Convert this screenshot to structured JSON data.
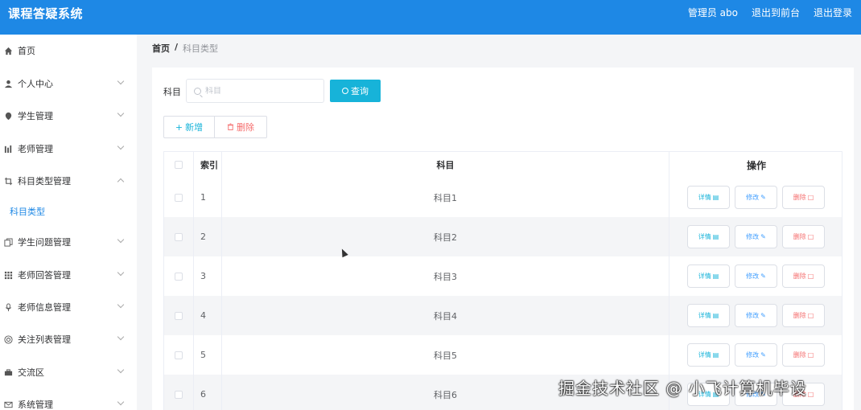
{
  "header": {
    "brand": "课程答疑系统",
    "admin": "管理员 abo",
    "back_front": "退出到前台",
    "logout": "退出登录"
  },
  "sidebar": {
    "items": [
      {
        "label": "首页",
        "icon": "home-icon",
        "expand": "none"
      },
      {
        "label": "个人中心",
        "icon": "user-icon",
        "expand": "down"
      },
      {
        "label": "学生管理",
        "icon": "location-icon",
        "expand": "down"
      },
      {
        "label": "老师管理",
        "icon": "chart-icon",
        "expand": "down"
      },
      {
        "label": "科目类型管理",
        "icon": "crop-icon",
        "expand": "up"
      },
      {
        "label": "学生问题管理",
        "icon": "copy-icon",
        "expand": "down"
      },
      {
        "label": "老师回答管理",
        "icon": "grid-icon",
        "expand": "down"
      },
      {
        "label": "老师信息管理",
        "icon": "mic-icon",
        "expand": "down"
      },
      {
        "label": "关注列表管理",
        "icon": "help-icon",
        "expand": "down"
      },
      {
        "label": "交流区",
        "icon": "briefcase-icon",
        "expand": "down"
      },
      {
        "label": "系统管理",
        "icon": "mail-icon",
        "expand": "down"
      }
    ],
    "sub_active": "科目类型"
  },
  "breadcrumb": {
    "home": "首页",
    "sep": "/",
    "current": "科目类型"
  },
  "search": {
    "label": "科目",
    "placeholder": "科目",
    "value": "",
    "query_button": "查询"
  },
  "toolbar": {
    "add_label": "新增",
    "delete_label": "删除"
  },
  "table": {
    "columns": [
      "索引",
      "科目",
      "操作"
    ],
    "rows": [
      {
        "index": "1",
        "subject": "科目1"
      },
      {
        "index": "2",
        "subject": "科目2"
      },
      {
        "index": "3",
        "subject": "科目3"
      },
      {
        "index": "4",
        "subject": "科目4"
      },
      {
        "index": "5",
        "subject": "科目5"
      },
      {
        "index": "6",
        "subject": "科目6"
      }
    ],
    "actions": {
      "detail": "详情",
      "edit": "修改",
      "remove": "删除"
    }
  },
  "colors": {
    "header_bg": "#1e88e5",
    "accent": "#17b3d9",
    "danger": "#f56c6c",
    "primary": "#409eff"
  },
  "watermark": "掘金技术社区 @ 小飞计算机毕设"
}
